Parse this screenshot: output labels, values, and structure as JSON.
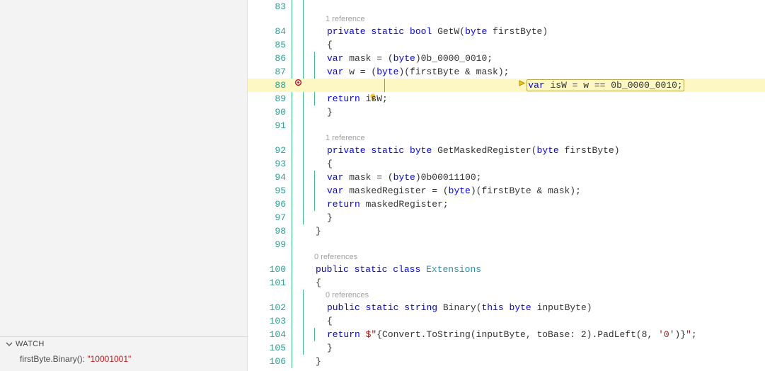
{
  "sidebar": {
    "watch": {
      "title": "WATCH",
      "items": [
        {
          "expr": "firstByte.Binary()",
          "sep": ": ",
          "value": "\"10001001\""
        }
      ]
    }
  },
  "codelens": {
    "ref1": "1 reference",
    "ref1b": "1 reference",
    "ref0a": "0 references",
    "ref0b": "0 references"
  },
  "code": {
    "l83": "",
    "l84_kw1": "private",
    "l84_kw2": "static",
    "l84_kw3": "bool",
    "l84_fn": "GetW",
    "l84_kw4": "byte",
    "l84_id": "firstByte",
    "l85": "{",
    "l86_kw1": "var",
    "l86_id": "mask = ",
    "l86_kw2": "byte",
    "l86_suf": ")0b_0000_0010;",
    "l87_kw1": "var",
    "l87_rest": " w = (",
    "l87_kw2": "byte",
    "l87_suf": ")(firstByte & mask);",
    "l88_kw1": "var",
    "l88_rest": " isW = w == 0b_0000_0010;",
    "l89_kw1": "return",
    "l89_rest": " isW;",
    "l90": "}",
    "l91": "",
    "l92_kw1": "private",
    "l92_kw2": "static",
    "l92_kw3": "byte",
    "l92_fn": "GetMaskedRegister",
    "l92_kw4": "byte",
    "l92_id": "firstByte",
    "l93": "{",
    "l94_kw1": "var",
    "l94_id": "mask = ",
    "l94_kw2": "byte",
    "l94_suf": ")0b00011100;",
    "l95_kw1": "var",
    "l95_id": "maskedRegister = ",
    "l95_kw2": "byte",
    "l95_suf": ")(firstByte & mask);",
    "l96_kw1": "return",
    "l96_rest": " maskedRegister;",
    "l97": "}",
    "l98": "}",
    "l99": "",
    "l100_kw1": "public",
    "l100_kw2": "static",
    "l100_kw3": "class",
    "l100_ty": "Extensions",
    "l101": "{",
    "l102_kw1": "public",
    "l102_kw2": "static",
    "l102_kw3": "string",
    "l102_fn": "Binary",
    "l102_kw4": "this",
    "l102_kw5": "byte",
    "l102_id": "inputByte",
    "l103": "{",
    "l104_kw1": "return",
    "l104_str1": " $\"",
    "l104_mid1": "{Convert.ToString(inputByte, toBase: 2).PadLeft(8, ",
    "l104_str2": "'0'",
    "l104_mid2": ")}",
    "l104_str3": "\"",
    "l104_end": ";",
    "l105": "}",
    "l106": "}"
  },
  "nums": {
    "l83": "83",
    "l84": "84",
    "l85": "85",
    "l86": "86",
    "l87": "87",
    "l88": "88",
    "l89": "89",
    "l90": "90",
    "l91": "91",
    "l92": "92",
    "l93": "93",
    "l94": "94",
    "l95": "95",
    "l96": "96",
    "l97": "97",
    "l98": "98",
    "l99": "99",
    "l100": "100",
    "l101": "101",
    "l102": "102",
    "l103": "103",
    "l104": "104",
    "l105": "105",
    "l106": "106"
  }
}
